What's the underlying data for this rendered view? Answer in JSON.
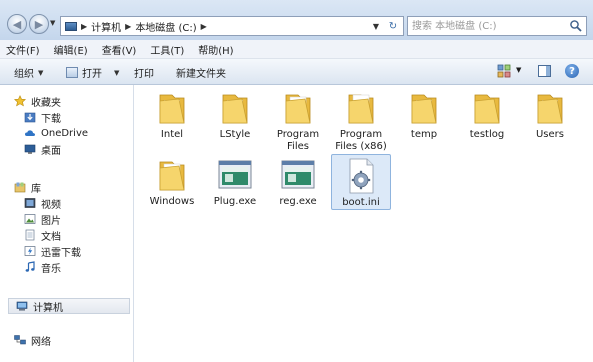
{
  "address_bar": {
    "path": [
      "计算机",
      "本地磁盘 (C:)"
    ],
    "search_placeholder": "搜索 本地磁盘 (C:)"
  },
  "menu": [
    "文件(F)",
    "编辑(E)",
    "查看(V)",
    "工具(T)",
    "帮助(H)"
  ],
  "toolbar": {
    "organize": "组织",
    "open": "打开",
    "print": "打印",
    "new_folder": "新建文件夹"
  },
  "sidebar": {
    "favorites": "收藏夹",
    "favorites_items": [
      "下载",
      "OneDrive",
      "桌面"
    ],
    "libraries": "库",
    "libraries_items": [
      "视频",
      "图片",
      "文档",
      "迅雷下载",
      "音乐"
    ],
    "computer": "计算机",
    "network": "网络"
  },
  "items": [
    {
      "label": "Intel",
      "type": "folder"
    },
    {
      "label": "LStyle",
      "type": "folder"
    },
    {
      "label": "Program Files",
      "type": "folder"
    },
    {
      "label": "Program Files (x86)",
      "type": "folder"
    },
    {
      "label": "temp",
      "type": "folder"
    },
    {
      "label": "testlog",
      "type": "folder"
    },
    {
      "label": "Users",
      "type": "folder"
    },
    {
      "label": "Windows",
      "type": "folder"
    },
    {
      "label": "Plug.exe",
      "type": "exe"
    },
    {
      "label": "reg.exe",
      "type": "exe"
    },
    {
      "label": "boot.ini",
      "type": "ini",
      "selected": true
    }
  ],
  "colors": {
    "folder": "#f3cf5f",
    "selection": "#dce9f8",
    "accent": "#2a64b3"
  }
}
